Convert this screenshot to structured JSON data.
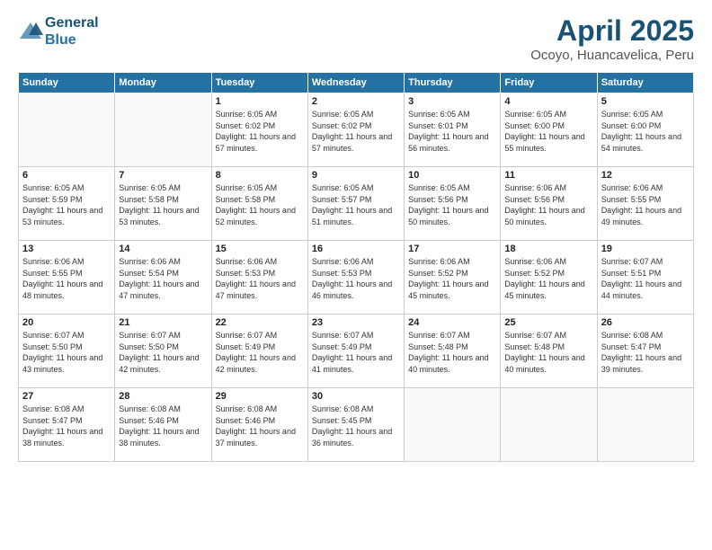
{
  "header": {
    "logo_line1": "General",
    "logo_line2": "Blue",
    "month": "April 2025",
    "location": "Ocoyo, Huancavelica, Peru"
  },
  "weekdays": [
    "Sunday",
    "Monday",
    "Tuesday",
    "Wednesday",
    "Thursday",
    "Friday",
    "Saturday"
  ],
  "weeks": [
    [
      {
        "day": "",
        "info": ""
      },
      {
        "day": "",
        "info": ""
      },
      {
        "day": "1",
        "info": "Sunrise: 6:05 AM\nSunset: 6:02 PM\nDaylight: 11 hours and 57 minutes."
      },
      {
        "day": "2",
        "info": "Sunrise: 6:05 AM\nSunset: 6:02 PM\nDaylight: 11 hours and 57 minutes."
      },
      {
        "day": "3",
        "info": "Sunrise: 6:05 AM\nSunset: 6:01 PM\nDaylight: 11 hours and 56 minutes."
      },
      {
        "day": "4",
        "info": "Sunrise: 6:05 AM\nSunset: 6:00 PM\nDaylight: 11 hours and 55 minutes."
      },
      {
        "day": "5",
        "info": "Sunrise: 6:05 AM\nSunset: 6:00 PM\nDaylight: 11 hours and 54 minutes."
      }
    ],
    [
      {
        "day": "6",
        "info": "Sunrise: 6:05 AM\nSunset: 5:59 PM\nDaylight: 11 hours and 53 minutes."
      },
      {
        "day": "7",
        "info": "Sunrise: 6:05 AM\nSunset: 5:58 PM\nDaylight: 11 hours and 53 minutes."
      },
      {
        "day": "8",
        "info": "Sunrise: 6:05 AM\nSunset: 5:58 PM\nDaylight: 11 hours and 52 minutes."
      },
      {
        "day": "9",
        "info": "Sunrise: 6:05 AM\nSunset: 5:57 PM\nDaylight: 11 hours and 51 minutes."
      },
      {
        "day": "10",
        "info": "Sunrise: 6:05 AM\nSunset: 5:56 PM\nDaylight: 11 hours and 50 minutes."
      },
      {
        "day": "11",
        "info": "Sunrise: 6:06 AM\nSunset: 5:56 PM\nDaylight: 11 hours and 50 minutes."
      },
      {
        "day": "12",
        "info": "Sunrise: 6:06 AM\nSunset: 5:55 PM\nDaylight: 11 hours and 49 minutes."
      }
    ],
    [
      {
        "day": "13",
        "info": "Sunrise: 6:06 AM\nSunset: 5:55 PM\nDaylight: 11 hours and 48 minutes."
      },
      {
        "day": "14",
        "info": "Sunrise: 6:06 AM\nSunset: 5:54 PM\nDaylight: 11 hours and 47 minutes."
      },
      {
        "day": "15",
        "info": "Sunrise: 6:06 AM\nSunset: 5:53 PM\nDaylight: 11 hours and 47 minutes."
      },
      {
        "day": "16",
        "info": "Sunrise: 6:06 AM\nSunset: 5:53 PM\nDaylight: 11 hours and 46 minutes."
      },
      {
        "day": "17",
        "info": "Sunrise: 6:06 AM\nSunset: 5:52 PM\nDaylight: 11 hours and 45 minutes."
      },
      {
        "day": "18",
        "info": "Sunrise: 6:06 AM\nSunset: 5:52 PM\nDaylight: 11 hours and 45 minutes."
      },
      {
        "day": "19",
        "info": "Sunrise: 6:07 AM\nSunset: 5:51 PM\nDaylight: 11 hours and 44 minutes."
      }
    ],
    [
      {
        "day": "20",
        "info": "Sunrise: 6:07 AM\nSunset: 5:50 PM\nDaylight: 11 hours and 43 minutes."
      },
      {
        "day": "21",
        "info": "Sunrise: 6:07 AM\nSunset: 5:50 PM\nDaylight: 11 hours and 42 minutes."
      },
      {
        "day": "22",
        "info": "Sunrise: 6:07 AM\nSunset: 5:49 PM\nDaylight: 11 hours and 42 minutes."
      },
      {
        "day": "23",
        "info": "Sunrise: 6:07 AM\nSunset: 5:49 PM\nDaylight: 11 hours and 41 minutes."
      },
      {
        "day": "24",
        "info": "Sunrise: 6:07 AM\nSunset: 5:48 PM\nDaylight: 11 hours and 40 minutes."
      },
      {
        "day": "25",
        "info": "Sunrise: 6:07 AM\nSunset: 5:48 PM\nDaylight: 11 hours and 40 minutes."
      },
      {
        "day": "26",
        "info": "Sunrise: 6:08 AM\nSunset: 5:47 PM\nDaylight: 11 hours and 39 minutes."
      }
    ],
    [
      {
        "day": "27",
        "info": "Sunrise: 6:08 AM\nSunset: 5:47 PM\nDaylight: 11 hours and 38 minutes."
      },
      {
        "day": "28",
        "info": "Sunrise: 6:08 AM\nSunset: 5:46 PM\nDaylight: 11 hours and 38 minutes."
      },
      {
        "day": "29",
        "info": "Sunrise: 6:08 AM\nSunset: 5:46 PM\nDaylight: 11 hours and 37 minutes."
      },
      {
        "day": "30",
        "info": "Sunrise: 6:08 AM\nSunset: 5:45 PM\nDaylight: 11 hours and 36 minutes."
      },
      {
        "day": "",
        "info": ""
      },
      {
        "day": "",
        "info": ""
      },
      {
        "day": "",
        "info": ""
      }
    ]
  ]
}
